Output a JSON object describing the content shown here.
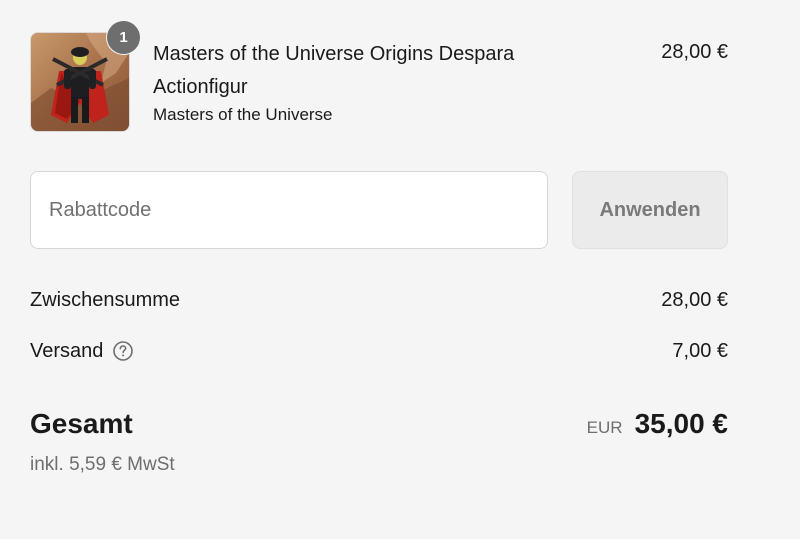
{
  "line_item": {
    "quantity": "1",
    "title": "Masters of the Universe Origins Despara Actionfigur",
    "vendor": "Masters of the Universe",
    "price": "28,00 €",
    "thumbnail_icon": "action-figure-image"
  },
  "discount": {
    "placeholder": "Rabattcode",
    "value": "",
    "apply_label": "Anwenden"
  },
  "totals": {
    "subtotal_label": "Zwischensumme",
    "subtotal_value": "28,00 €",
    "shipping_label": "Versand",
    "shipping_help_icon": "question-circle-icon",
    "shipping_value": "7,00 €",
    "total_label": "Gesamt",
    "currency": "EUR",
    "total_value": "35,00 €",
    "tax_note": "inkl. 5,59 € MwSt"
  },
  "colors": {
    "background": "#f5f5f5",
    "text": "#1a1a1a",
    "muted": "#6e6e6e",
    "badge": "#6e6e6e",
    "button_bg": "#ebebeb"
  }
}
